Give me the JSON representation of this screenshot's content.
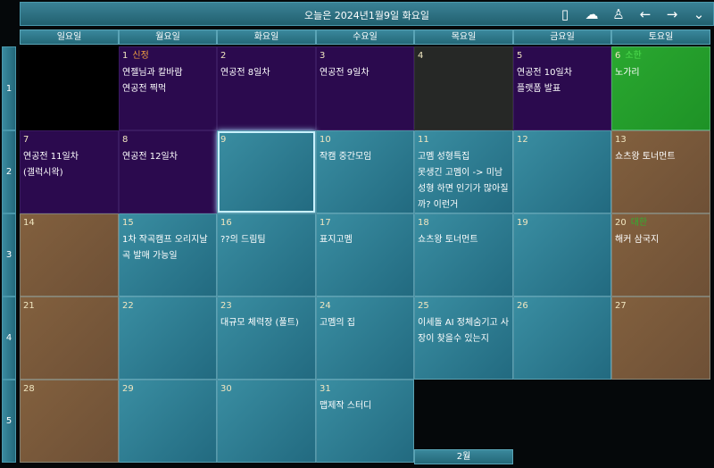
{
  "header": {
    "title": "오늘은 2024년1월9일 화요일",
    "icons": [
      {
        "name": "phone-icon",
        "glyph": "▯"
      },
      {
        "name": "cloud-check-icon",
        "glyph": "☁"
      },
      {
        "name": "user-icon",
        "glyph": "♙"
      },
      {
        "name": "arrow-left-icon",
        "glyph": "←"
      },
      {
        "name": "arrow-right-icon",
        "glyph": "→"
      },
      {
        "name": "chevron-down-icon",
        "glyph": "⌄"
      }
    ]
  },
  "weekdays": [
    "일요일",
    "월요일",
    "화요일",
    "수요일",
    "목요일",
    "금요일",
    "토요일"
  ],
  "weeks": [
    "1",
    "2",
    "3",
    "4",
    "5"
  ],
  "colors": {
    "holiday_red": "#f0a040",
    "holiday_green": "#40c040"
  },
  "days": [
    {
      "day": "",
      "style": "empty",
      "events": []
    },
    {
      "day": "1",
      "holiday": "신정",
      "holiday_color": "#f0a040",
      "style": "purple",
      "events": [
        "연젤님과 칼바람",
        "연공전 찍먹"
      ]
    },
    {
      "day": "2",
      "style": "purple",
      "events": [
        "연공전 8일차"
      ]
    },
    {
      "day": "3",
      "style": "purple",
      "events": [
        "연공전 9일차"
      ]
    },
    {
      "day": "4",
      "style": "dark",
      "events": []
    },
    {
      "day": "5",
      "style": "purple",
      "events": [
        "연공전 10일차",
        "플랫폼 발표"
      ]
    },
    {
      "day": "6",
      "holiday": "소한",
      "holiday_color": "#50e050",
      "style": "green",
      "events": [
        "노가리"
      ]
    },
    {
      "day": "7",
      "style": "purple",
      "events": [
        "연공전 11일차",
        "(갤럭시왁)"
      ]
    },
    {
      "day": "8",
      "style": "purple",
      "events": [
        "연공전 12일차"
      ]
    },
    {
      "day": "9",
      "style": "teal",
      "selected": true,
      "events": []
    },
    {
      "day": "10",
      "style": "teal",
      "events": [
        "작캠 중간모임"
      ]
    },
    {
      "day": "11",
      "style": "teal",
      "events": [
        "고멤 성형특집",
        "못생긴 고멤이 -> 미남성형 하면 인기가 많아질까? 이런거"
      ]
    },
    {
      "day": "12",
      "style": "teal",
      "events": []
    },
    {
      "day": "13",
      "style": "brown",
      "events": [
        "쇼츠왕 토너먼트"
      ]
    },
    {
      "day": "14",
      "style": "brown",
      "events": []
    },
    {
      "day": "15",
      "style": "teal",
      "events": [
        "1차 작곡캠프 오리지날 곡 발매 가능일"
      ]
    },
    {
      "day": "16",
      "style": "teal",
      "events": [
        "??의 드림팀"
      ]
    },
    {
      "day": "17",
      "style": "teal",
      "events": [
        "표지고멤"
      ]
    },
    {
      "day": "18",
      "style": "teal",
      "events": [
        "쇼츠왕 토너먼트"
      ]
    },
    {
      "day": "19",
      "style": "teal",
      "events": []
    },
    {
      "day": "20",
      "holiday": "대한",
      "holiday_color": "#30b030",
      "style": "brown",
      "events": [
        "해커 삼국지"
      ]
    },
    {
      "day": "21",
      "style": "brown",
      "events": []
    },
    {
      "day": "22",
      "style": "teal",
      "events": []
    },
    {
      "day": "23",
      "style": "teal",
      "events": [
        "대규모 체력장 (풀트)"
      ]
    },
    {
      "day": "24",
      "style": "teal",
      "events": [
        "고멤의 집"
      ]
    },
    {
      "day": "25",
      "style": "teal",
      "events": [
        "이세돌 AI 정체숨기고 사장이 찾을수 있는지"
      ]
    },
    {
      "day": "26",
      "style": "teal",
      "events": []
    },
    {
      "day": "27",
      "style": "brown",
      "events": []
    },
    {
      "day": "28",
      "style": "brown",
      "events": []
    },
    {
      "day": "29",
      "style": "teal",
      "events": []
    },
    {
      "day": "30",
      "style": "teal",
      "events": []
    },
    {
      "day": "31",
      "style": "teal",
      "events": [
        "맵제작 스터디"
      ]
    }
  ],
  "next_month_label": "2월"
}
